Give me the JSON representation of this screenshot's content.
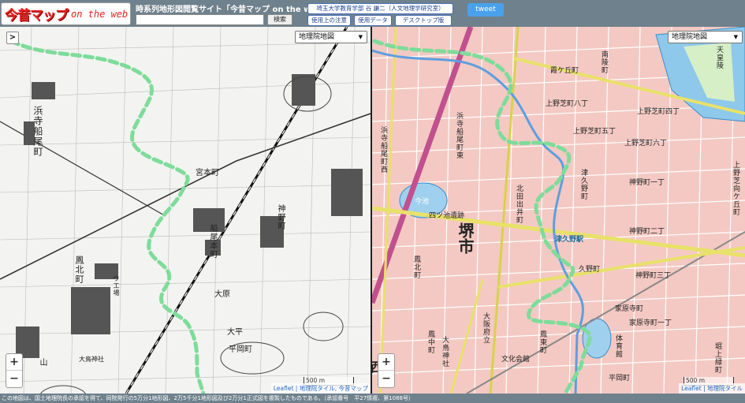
{
  "header": {
    "logo_main": "今昔マップ",
    "logo_sub": "on the web",
    "site_title": "時系列地形図閲覧サイト「今昔マップ on the web」",
    "search_placeholder": "",
    "search_label": "検索",
    "author_link": "埼玉大学教育学部 谷 謙二（人文地理学研究室）",
    "notice_link": "使用上の注意",
    "data_link": "使用データ",
    "desktop_link": "デスクトップ版",
    "tweet_label": "tweet"
  },
  "left_map": {
    "layer_select": "地理院地図",
    "toggle_label": ">",
    "zoom_in": "+",
    "zoom_out": "−",
    "scale_label": "500 m",
    "attribution": "Leaflet | 地理院タイル, 今昔マップ",
    "labels": {
      "hamadera": "浜寺船尾町",
      "miyamoto": "宮本町",
      "funao": "船尾本町",
      "jinno": "神野町",
      "ohara": "大原",
      "taihei": "大平",
      "hiramachi": "平岡町",
      "takakita": "鳳北町",
      "otori": "大鳥神社",
      "yamato": "山",
      "kokumin": "ウ工場"
    }
  },
  "right_map": {
    "layer_select": "地理院地図",
    "zoom_in": "+",
    "zoom_out": "−",
    "scale_label": "500 m",
    "attribution": "Leaflet | 地理院タイル",
    "labels": {
      "sakai_city": "堺市",
      "imaike": "今池",
      "shijo": "四ツ池遺跡",
      "tennoryo": "天皇陵",
      "kasumigaoka": "霞ケ丘町",
      "minamikyo": "南陵町",
      "ueno1": "上野芝町八丁",
      "ueno2": "上野芝町四丁",
      "ueno3": "上野芝町五丁",
      "ueno4": "上野芝町六丁",
      "ueno5": "上野芝向ケ丘町",
      "tsukuno": "津久野町",
      "tsukuno_st": "津久野駅",
      "jinno2": "神野町二丁",
      "jinno3": "神野町三丁",
      "jinno1": "神野町一丁",
      "kuno": "久野町",
      "ohama": "鳳北町",
      "otori_east": "鳳東町",
      "otori_n": "鳳中町",
      "kadohara": "家原寺町",
      "kadohara2": "家原寺町一丁",
      "osaka_pref": "大阪府立",
      "bunka": "文化会館",
      "taiikukan": "体育館",
      "hiraoka": "平岡町",
      "hamadera_n": "浜寺船尾町東",
      "hamadera_w": "浜寺船尾町西",
      "horikami": "堀上緑町",
      "sakai_eki": "大鳥神社",
      "kitamachi": "北田出井町",
      "nishi": "西"
    }
  },
  "footer_text": "この地図は、国土地理院長の承認を得て、同院発行の5万分1地形図、2万5千分1地形図及び2万分1正式図を複製したものである。（承認番号　平27情複、第1088号）"
}
